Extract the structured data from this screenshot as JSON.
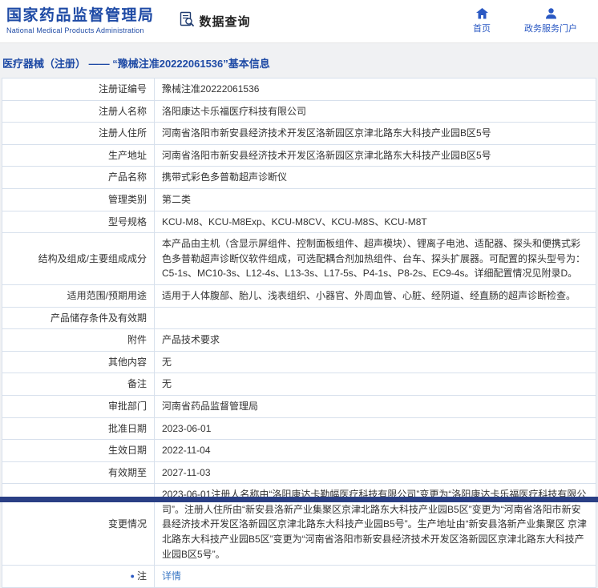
{
  "header": {
    "org_name_cn": "国家药品监督管理局",
    "org_name_en": "National Medical Products Administration",
    "module_title": "数据查询",
    "nav_home": "首页",
    "nav_portal": "政务服务门户"
  },
  "breadcrumb": {
    "text": "医疗器械（注册） ——  “豫械注准20222061536”基本信息"
  },
  "colors": {
    "brand_blue": "#1e4aa5",
    "nav_blue": "#2b59c3",
    "link_blue": "#3a77c4",
    "border_blue": "#d7e0ec",
    "footer_navy": "#2a3f85"
  },
  "table": {
    "rows": [
      {
        "label": "注册证编号",
        "value": "豫械注准20222061536"
      },
      {
        "label": "注册人名称",
        "value": "洛阳康达卡乐福医疗科技有限公司"
      },
      {
        "label": "注册人住所",
        "value": "河南省洛阳市新安县经济技术开发区洛新园区京津北路东大科技产业园B区5号"
      },
      {
        "label": "生产地址",
        "value": "河南省洛阳市新安县经济技术开发区洛新园区京津北路东大科技产业园B区5号"
      },
      {
        "label": "产品名称",
        "value": "携带式彩色多普勒超声诊断仪"
      },
      {
        "label": "管理类别",
        "value": "第二类"
      },
      {
        "label": "型号规格",
        "value": "KCU-M8、KCU-M8Exp、KCU-M8CV、KCU-M8S、KCU-M8T"
      },
      {
        "label": "结构及组成/主要组成成分",
        "value": "本产品由主机（含显示屏组件、控制面板组件、超声模块）、锂离子电池、适配器、探头和便携式彩色多普勒超声诊断仪软件组成，可选配耦合剂加热组件、台车、探头扩展器。可配置的探头型号为：C5-1s、MC10-3s、L12-4s、L13-3s、L17-5s、P4-1s、P8-2s、EC9-4s。详细配置情况见附录D。"
      },
      {
        "label": "适用范围/预期用途",
        "value": "适用于人体腹部、胎儿、浅表组织、小器官、外周血管、心脏、经阴道、经直肠的超声诊断检查。"
      },
      {
        "label": "产品储存条件及有效期",
        "value": ""
      },
      {
        "label": "附件",
        "value": "产品技术要求"
      },
      {
        "label": "其他内容",
        "value": "无"
      },
      {
        "label": "备注",
        "value": "无"
      },
      {
        "label": "审批部门",
        "value": "河南省药品监督管理局"
      },
      {
        "label": "批准日期",
        "value": "2023-06-01"
      },
      {
        "label": "生效日期",
        "value": "2022-11-04"
      },
      {
        "label": "有效期至",
        "value": "2027-11-03"
      },
      {
        "label": "变更情况",
        "value": "2023-06-01注册人名称由“洛阳康达卡勒幅医疗科技有限公司”变更为“洛阳康达卡乐福医疗科技有限公司”。注册人住所由“新安县洛新产业集聚区京津北路东大科技产业园B5区”变更为“河南省洛阳市新安县经济技术开发区洛新园区京津北路东大科技产业园B5号”。生产地址由“新安县洛新产业集聚区 京津北路东大科技产业园B5区”变更为“河南省洛阳市新安县经济技术开发区洛新园区京津北路东大科技产业园B区5号”。"
      },
      {
        "label": "注",
        "value": "详情"
      }
    ]
  }
}
